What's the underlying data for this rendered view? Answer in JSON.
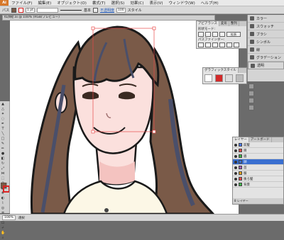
{
  "app": {
    "logo": "Ai"
  },
  "menubar": {
    "items": [
      "ファイル(F)",
      "編集(E)",
      "オブジェクト(O)",
      "書式(T)",
      "選択(S)",
      "効果(C)",
      "表示(V)",
      "ウィンドウ(W)",
      "ヘルプ(H)"
    ]
  },
  "control": {
    "label_path": "パス",
    "stroke_weight": "1 pt",
    "stroke_style": "基本",
    "opacity_label": "不透明度",
    "opacity_value": "100",
    "style_label": "スタイル"
  },
  "document": {
    "tab_title": "似顔絵.ai @ 100% (RGB/プレビュー)"
  },
  "pathfinder": {
    "tabs": [
      "アピアランス",
      "変形",
      "整列"
    ],
    "active_tab": "アピアランス",
    "shape_modes_label": "形状モード:",
    "pathfinder_label": "パスファインダー:",
    "expand_label": "拡張"
  },
  "graphic_styles": {
    "tabs": [
      "グラフィックスタイル"
    ]
  },
  "dock": {
    "items": [
      {
        "label": "カラー",
        "icon": "color-icon"
      },
      {
        "label": "スウォッチ",
        "icon": "swatches-icon"
      },
      {
        "label": "ブラシ",
        "icon": "brush-icon"
      },
      {
        "label": "シンボル",
        "icon": "symbol-icon"
      },
      {
        "label": "線",
        "icon": "stroke-icon"
      },
      {
        "label": "グラデーション",
        "icon": "gradient-icon"
      },
      {
        "label": "透明",
        "icon": "transparency-icon"
      }
    ]
  },
  "layers": {
    "tabs": [
      "レイヤー",
      "アートボード"
    ],
    "rows": [
      {
        "name": "前髪",
        "color": "#4a78ff"
      },
      {
        "name": "目",
        "color": "#ff4a4a"
      },
      {
        "name": "眉",
        "color": "#3fb24a"
      },
      {
        "name": "顔",
        "color": "#3a6fd0"
      },
      {
        "name": "首",
        "color": "#9b59b6"
      },
      {
        "name": "服",
        "color": "#e6a21e"
      },
      {
        "name": "後ろ髪",
        "color": "#ff4a4a"
      },
      {
        "name": "背景",
        "color": "#3fb24a"
      }
    ],
    "selected_index": 3,
    "footer": "8 レイヤー"
  },
  "status": {
    "zoom": "100%",
    "tool": "選択"
  },
  "colors": {
    "hair": "#7a5a48",
    "hair_shade": "#4a4f6a",
    "skin": "#fbe0dd",
    "cheek": "#f4c3c0",
    "shirt": "#fcf7e6",
    "background": "#6b6b6b"
  }
}
